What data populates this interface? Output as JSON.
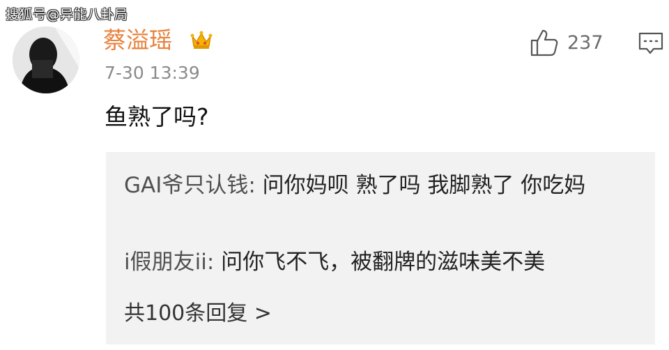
{
  "watermark": "搜狐号@异能八卦局",
  "post": {
    "username": "蔡溢瑶",
    "timestamp": "7-30 13:39",
    "content": "鱼熟了吗?",
    "like_count": "237",
    "badge_icon": "crown-icon",
    "like_icon": "thumbs-up-icon",
    "comment_icon": "comment-icon"
  },
  "replies": [
    {
      "author": "GAI爷只认钱: ",
      "text": "问你妈呗 熟了吗 我脚熟了 你吃妈"
    },
    {
      "author": "i假朋友ii: ",
      "text": "问你飞不飞，被翻牌的滋味美不美"
    }
  ],
  "more_replies": "共100条回复 >",
  "colors": {
    "username": "#e8813a",
    "timestamp": "#8a8a8a",
    "reply_bg": "#f2f2f2",
    "watermark_text": "#ffffff"
  }
}
